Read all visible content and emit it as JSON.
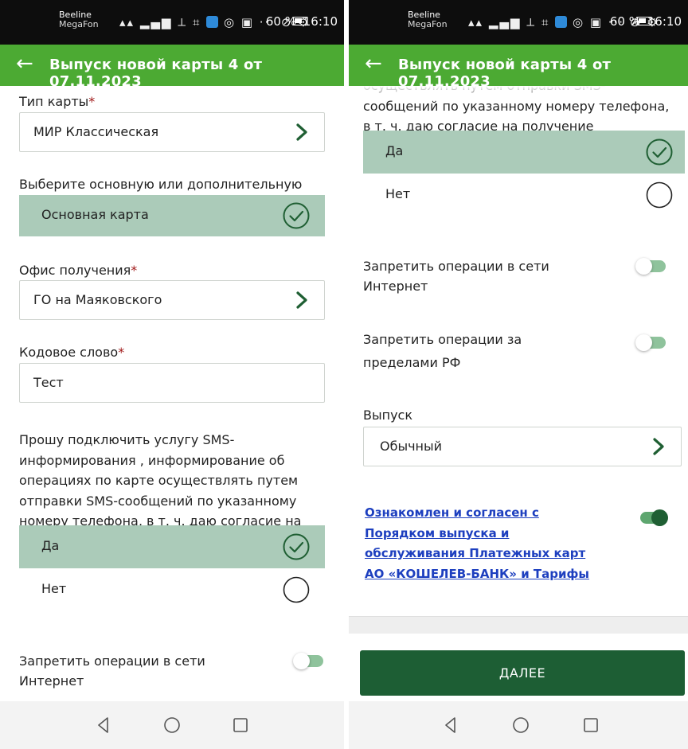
{
  "status_bar": {
    "carrier_top": "Beeline",
    "carrier_bottom": "MegaFon",
    "volte": "VoLTE",
    "battery": "60 %",
    "time": "16:10"
  },
  "app_bar": {
    "title": "Выпуск новой карты 4 от 07.11.2023"
  },
  "required_mark": "*",
  "left_screen": {
    "card_type": {
      "label": "Тип карты",
      "value": "МИР Классическая"
    },
    "main_or_additional": {
      "label": "Выберите основную или дополнительную карту ",
      "selected": "Основная карта"
    },
    "office": {
      "label": "Офис получения",
      "value": "ГО на Маяковского"
    },
    "code_word": {
      "label": "Кодовое слово",
      "value": "Тест"
    },
    "sms_consent": {
      "text": "Прошу подключить услугу SMS-информирования , информирование об операциях по карте осуществлять путем отправки SMS-сообщений по указанному номеру телефона, в т. ч. даю согласие на получение информационных сообщений.",
      "options": [
        {
          "label": "Да",
          "selected": true
        },
        {
          "label": "Нет",
          "selected": false
        }
      ]
    },
    "block_internet": {
      "label": "Запретить операции в сети Интернет",
      "on": false
    }
  },
  "right_screen": {
    "sms_consent_tail": "осуществлять путем отправки SMS-сообщений по указанному номеру телефона, в т. ч. даю согласие на получение информационных сообщений.",
    "options": [
      {
        "label": "Да",
        "selected": true
      },
      {
        "label": "Нет",
        "selected": false
      }
    ],
    "block_internet": {
      "label": "Запретить операции в сети Интернет",
      "on": false
    },
    "block_abroad": {
      "label": "Запретить операции за пределами РФ",
      "on": false
    },
    "issue": {
      "label": "Выпуск",
      "value": "Обычный"
    },
    "agreement": {
      "link_text": "Ознакомлен и согласен с Порядком выпуска и обслуживания Платежных карт АО «КОШЕЛЕВ-БАНК» и Тарифы",
      "on": true
    },
    "next_button": "ДАЛЕЕ"
  },
  "colors": {
    "app_bar": "#4caa33",
    "selected_option": "#abcbb9",
    "primary_button": "#1d5e34",
    "check": "#1f5f33",
    "required": "#a01818",
    "link": "#1d3fbf"
  },
  "icons": {
    "back": "arrow-left-icon",
    "chevron": "chevron-right-icon",
    "check": "check-circle-icon",
    "radio": "radio-empty-icon",
    "nav": [
      "back-triangle-icon",
      "home-circle-icon",
      "recents-square-icon"
    ]
  }
}
